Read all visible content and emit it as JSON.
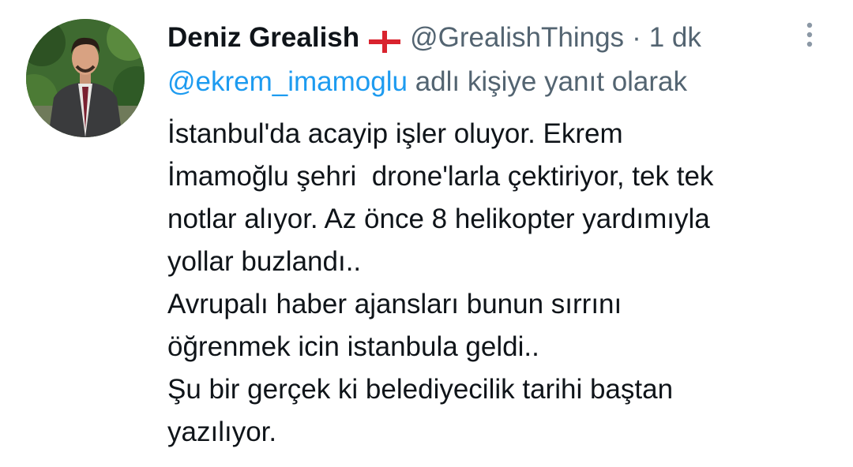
{
  "tweet": {
    "display_name": "Deniz Grealish",
    "flag_icon": "england-flag-icon",
    "handle": "@GrealishThings",
    "separator": "·",
    "time": "1 dk",
    "more_icon": "vertical-ellipsis-icon",
    "reply_mention": "@ekrem_imamoglu",
    "reply_suffix": " adlı kişiye yanıt olarak",
    "body_lines": [
      "İstanbul'da acayip işler oluyor. Ekrem",
      "İmamoğlu şehri  drone'larla çektiriyor, tek tek",
      "notlar alıyor. Az önce 8 helikopter yardımıyla",
      "yollar buzlandı..",
      "Avrupalı haber ajansları bunun sırrını",
      "öğrenmek icin istanbula geldi..",
      "Şu bir gerçek ki belediyecilik tarihi baştan",
      "yazılıyor."
    ]
  },
  "colors": {
    "primary_text": "#0f1419",
    "secondary_text": "#536471",
    "mention": "#1d9bf0",
    "flag_red": "#d9232e"
  }
}
